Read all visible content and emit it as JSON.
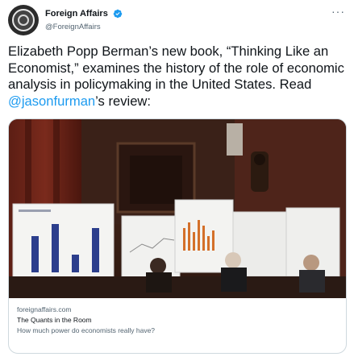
{
  "account": {
    "display_name": "Foreign Affairs",
    "handle": "@ForeignAffairs",
    "avatar_icon": "foreign-affairs-logo-icon",
    "verified_icon": "verified-badge-icon",
    "more_label": "···"
  },
  "tweet": {
    "text_before": "Elizabeth Popp Berman’s new book, “Thinking Like an Economist,” examines the history of the role of economic analysis in policymaking in the United States. Read ",
    "mention": "@jasonfurman",
    "text_after": "’s review:"
  },
  "card": {
    "domain": "foreignaffairs.com",
    "title": "The Quants in the Room",
    "description": "How much power do economists really have?"
  },
  "colors": {
    "link": "#1d9bf0",
    "verified": "#1d9bf0",
    "secondary_text": "#536471"
  }
}
